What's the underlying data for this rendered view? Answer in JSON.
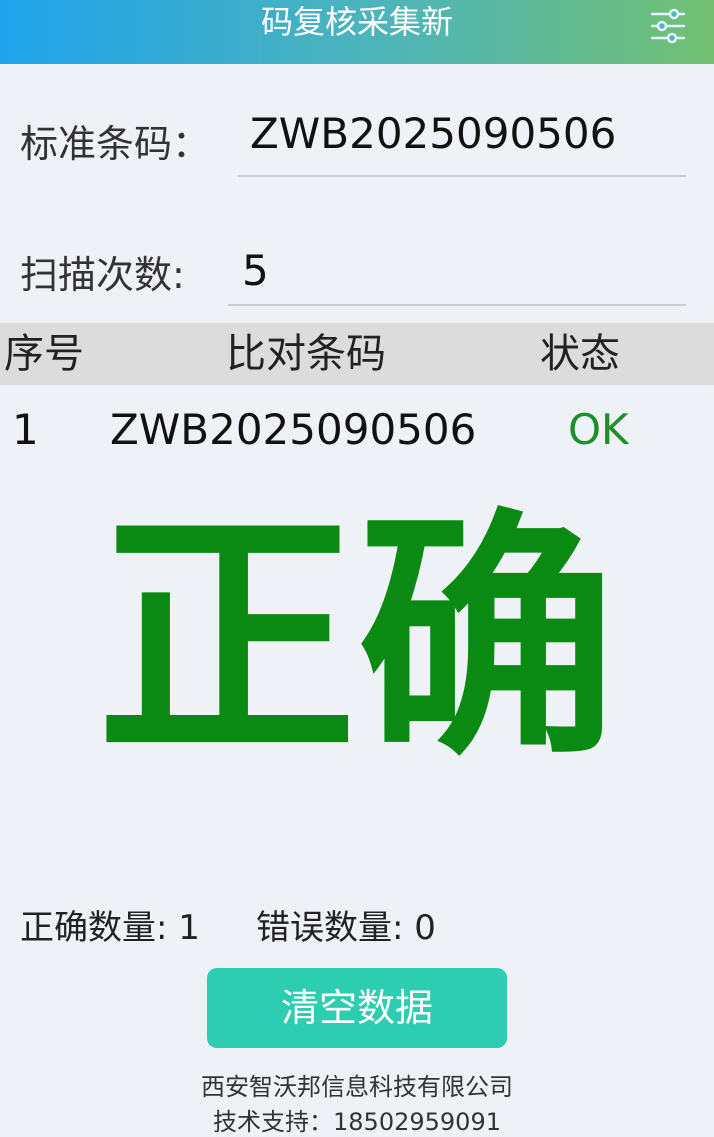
{
  "app": {
    "title": "码复核采集新",
    "settings_icon": "sliders-icon"
  },
  "form": {
    "standard_barcode_label": "标准条码：",
    "standard_barcode_value": "ZWB2025090506",
    "scan_count_label": "扫描次数:",
    "scan_count_value": "5"
  },
  "table": {
    "headers": [
      "序号",
      "比对条码",
      "状态"
    ],
    "rows": [
      {
        "index": "1",
        "barcode": "ZWB2025090506",
        "status": "OK"
      }
    ]
  },
  "result": {
    "text": "正确",
    "color": "#0a8a12"
  },
  "stats": {
    "correct_label": "正确数量: ",
    "correct_count": "1",
    "error_label": "错误数量: ",
    "error_count": "0"
  },
  "actions": {
    "clear_label": "清空数据"
  },
  "footer": {
    "company": "西安智沃邦信息科技有限公司",
    "support": "技术支持：18502959091"
  },
  "colors": {
    "header_gradient_start": "#1fa3ec",
    "header_gradient_end": "#73c072",
    "button": "#2dcdb2",
    "status_ok": "#1a8f2a"
  }
}
